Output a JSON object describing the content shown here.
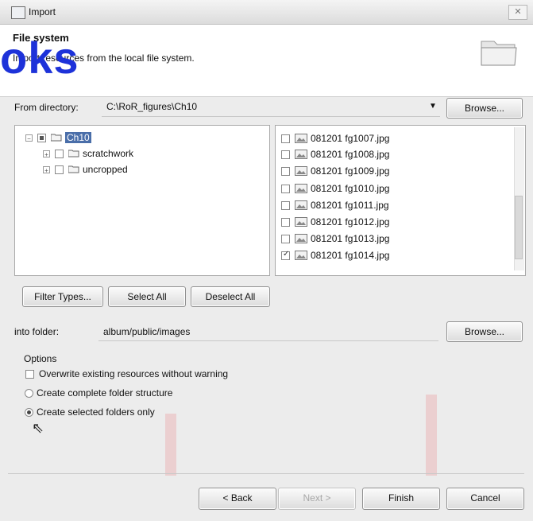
{
  "window": {
    "title": "Import",
    "close_label": "✕"
  },
  "header": {
    "title": "File system",
    "description": "Import resources from the local file system."
  },
  "watermark": {
    "text": "oks",
    "brand": "DropBooks"
  },
  "from_directory": {
    "label": "From directory:",
    "value": "C:\\RoR_figures\\Ch10",
    "browse_label": "Browse..."
  },
  "tree": {
    "items": [
      {
        "label": "Ch10"
      },
      {
        "label": "scratchwork"
      },
      {
        "label": "uncropped"
      }
    ]
  },
  "files": {
    "items": [
      {
        "label": "081201 fg1007.jpg",
        "checked": false
      },
      {
        "label": "081201 fg1008.jpg",
        "checked": false
      },
      {
        "label": "081201 fg1009.jpg",
        "checked": false
      },
      {
        "label": "081201 fg1010.jpg",
        "checked": false
      },
      {
        "label": "081201 fg1011.jpg",
        "checked": false
      },
      {
        "label": "081201 fg1012.jpg",
        "checked": false
      },
      {
        "label": "081201 fg1013.jpg",
        "checked": false
      },
      {
        "label": "081201 fg1014.jpg",
        "checked": true
      }
    ]
  },
  "selection_buttons": {
    "filter": "Filter Types...",
    "select_all": "Select All",
    "deselect_all": "Deselect All"
  },
  "into_folder": {
    "label": "into folder:",
    "value": "album/public/images",
    "browse_label": "Browse..."
  },
  "options": {
    "heading": "Options",
    "overwrite_label": "Overwrite existing resources without warning",
    "complete_structure_label": "Create complete folder structure",
    "selected_only_label": "Create selected folders only"
  },
  "footer": {
    "back": "< Back",
    "next": "Next >",
    "finish": "Finish",
    "cancel": "Cancel"
  },
  "colors": {
    "accent": "#4a6ea9",
    "watermark": "#1d32d9"
  }
}
